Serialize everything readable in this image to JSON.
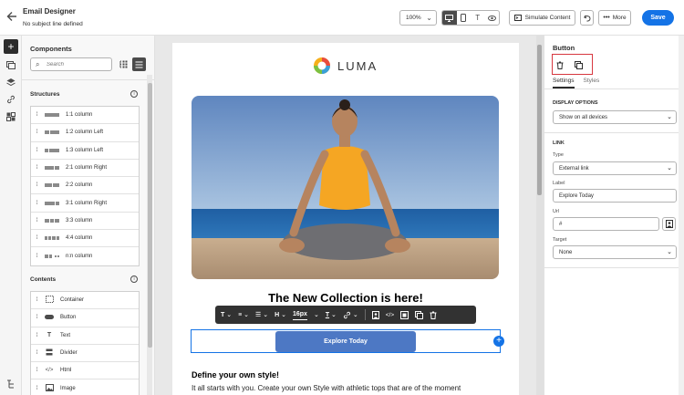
{
  "header": {
    "title": "Email Designer",
    "subtitle": "No subject line defined",
    "zoom": "100%",
    "simulate_label": "Simulate Content",
    "more_label": "More",
    "save_label": "Save"
  },
  "components": {
    "title": "Components",
    "search_placeholder": "Search",
    "structures_heading": "Structures",
    "structures": [
      {
        "label": "1:1 column"
      },
      {
        "label": "1:2 column Left"
      },
      {
        "label": "1:3 column Left"
      },
      {
        "label": "2:1 column Right"
      },
      {
        "label": "2:2 column"
      },
      {
        "label": "3:1 column Right"
      },
      {
        "label": "3:3 column"
      },
      {
        "label": "4:4 column"
      },
      {
        "label": "n:n column"
      }
    ],
    "contents_heading": "Contents",
    "contents": [
      {
        "label": "Container",
        "icon": "container-icon"
      },
      {
        "label": "Button",
        "icon": "button-icon"
      },
      {
        "label": "Text",
        "icon": "text-icon"
      },
      {
        "label": "Divider",
        "icon": "divider-icon"
      },
      {
        "label": "Html",
        "icon": "html-icon"
      },
      {
        "label": "Image",
        "icon": "image-icon"
      }
    ]
  },
  "email": {
    "logo_text": "LUMA",
    "headline": "The New Collection is here!",
    "toolbar": {
      "font_size": "16px"
    },
    "cta_label": "Explore Today",
    "subhead": "Define your own style!",
    "body": "It all starts with you. Create your own Style with athletic tops that are of the moment"
  },
  "properties": {
    "title": "Button",
    "tab_settings": "Settings",
    "tab_styles": "Styles",
    "display_options_heading": "DISPLAY OPTIONS",
    "display_value": "Show on all devices",
    "link_heading": "LINK",
    "type_label": "Type",
    "type_value": "External link",
    "label_label": "Label",
    "label_value": "Explore Today",
    "url_label": "Url",
    "url_value": "#",
    "target_label": "Target",
    "target_value": "None"
  },
  "colors": {
    "accent": "#1473e6",
    "cta": "#4d78c4",
    "toolbar": "#323232",
    "highlight": "#d7373f"
  }
}
